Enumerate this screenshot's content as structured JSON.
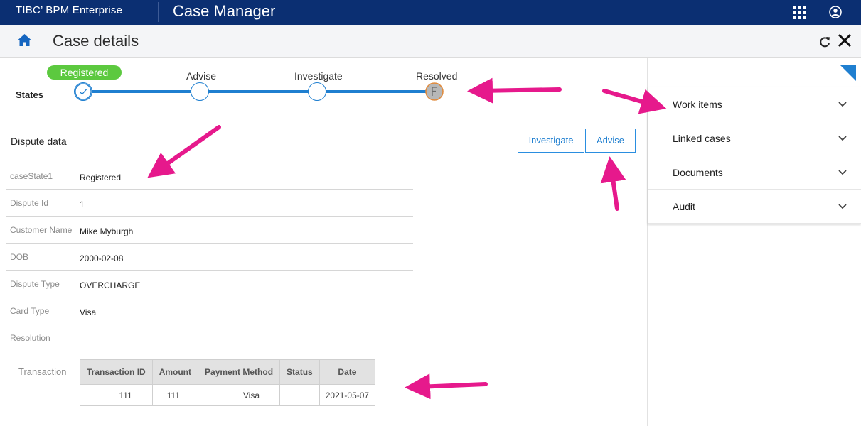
{
  "header": {
    "brand": "TIBC’ BPM Enterprise",
    "app_title": "Case Manager",
    "icons": [
      "apps-grid-icon",
      "user-account-icon"
    ]
  },
  "subheader": {
    "title": "Case details",
    "icons": [
      "home-icon",
      "refresh-icon",
      "close-icon"
    ]
  },
  "states": {
    "label": "States",
    "items": [
      {
        "name": "Registered",
        "status": "completed"
      },
      {
        "name": "Advise",
        "status": "pending"
      },
      {
        "name": "Investigate",
        "status": "pending"
      },
      {
        "name": "Resolved",
        "status": "final"
      }
    ]
  },
  "dispute": {
    "section_title": "Dispute data",
    "actions": [
      "Investigate",
      "Advise"
    ],
    "fields": [
      {
        "label": "caseState1",
        "value": "Registered"
      },
      {
        "label": "Dispute Id",
        "value": "1"
      },
      {
        "label": "Customer Name",
        "value": "Mike Myburgh"
      },
      {
        "label": "DOB",
        "value": "2000-02-08"
      },
      {
        "label": "Dispute Type",
        "value": "OVERCHARGE"
      },
      {
        "label": "Card Type",
        "value": "Visa"
      },
      {
        "label": "Resolution",
        "value": ""
      }
    ],
    "transaction": {
      "label": "Transaction",
      "columns": [
        "Transaction ID",
        "Amount",
        "Payment Method",
        "Status",
        "Date"
      ],
      "rows": [
        [
          "111",
          "111",
          "Visa",
          "",
          "2021-05-07"
        ]
      ]
    }
  },
  "sidebar": {
    "sections": [
      "Work items",
      "Linked cases",
      "Documents",
      "Audit"
    ]
  },
  "colors": {
    "header_bg": "#0b2f72",
    "accent": "#1f7fd0",
    "success": "#5cc93f",
    "annotation": "#e6198c"
  }
}
